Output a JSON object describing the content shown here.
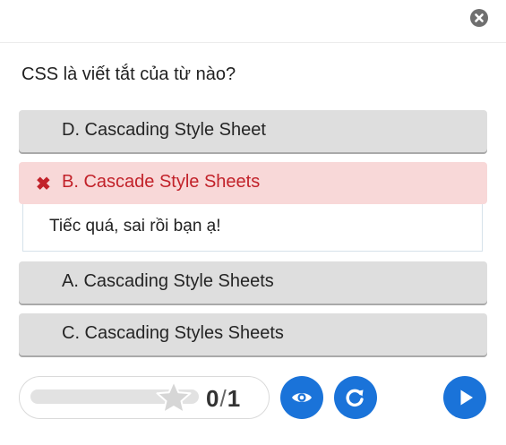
{
  "question": "CSS là viết tắt của từ nào?",
  "options": [
    {
      "label": "D. Cascading Style Sheet",
      "state": "default"
    },
    {
      "label": "B. Cascade Style Sheets",
      "state": "wrong"
    },
    {
      "label": "A. Cascading Style Sheets",
      "state": "default"
    },
    {
      "label": "C. Cascading Styles Sheets",
      "state": "default"
    }
  ],
  "wrong_mark": "✖",
  "feedback": "Tiếc quá, sai rồi bạn ạ!",
  "score": {
    "current": "0",
    "separator": "/",
    "total": "1"
  },
  "progress": 0,
  "icons": {
    "close": "close-icon",
    "star": "star-icon",
    "show_solution": "eye-icon",
    "retry": "retry-icon",
    "next": "play-icon"
  },
  "colors": {
    "option_bg": "#dedede",
    "wrong_bg": "#f8d8d8",
    "wrong_text": "#c2222a",
    "button_blue": "#1a73d9"
  }
}
